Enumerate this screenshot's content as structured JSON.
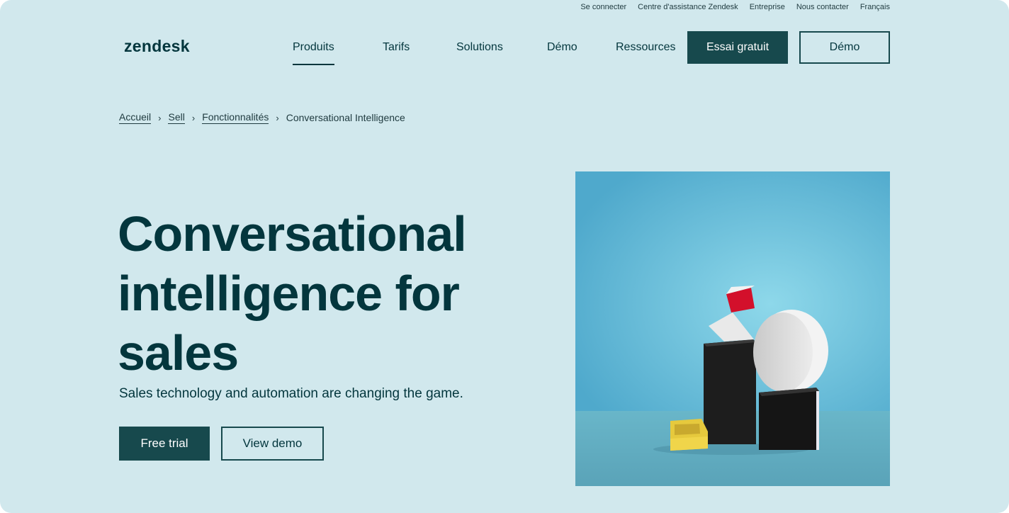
{
  "utility_nav": [
    "Se connecter",
    "Centre d'assistance Zendesk",
    "Entreprise",
    "Nous contacter",
    "Français"
  ],
  "header": {
    "logo": "zendesk",
    "nav": [
      "Produits",
      "Tarifs",
      "Solutions",
      "Démo",
      "Ressources"
    ],
    "active_nav": "Produits",
    "cta_primary": "Essai gratuit",
    "cta_secondary": "Démo"
  },
  "breadcrumb": {
    "items": [
      "Accueil",
      "Sell",
      "Fonctionnalités"
    ],
    "current": "Conversational Intelligence",
    "separator": "›"
  },
  "hero": {
    "title": "Conversational intelligence for sales",
    "subtitle": "Sales technology and automation are changing the game.",
    "primary_button": "Free trial",
    "secondary_button": "View demo"
  },
  "colors": {
    "background": "#d1e8ed",
    "primary": "#17494d",
    "text": "#03363d"
  }
}
